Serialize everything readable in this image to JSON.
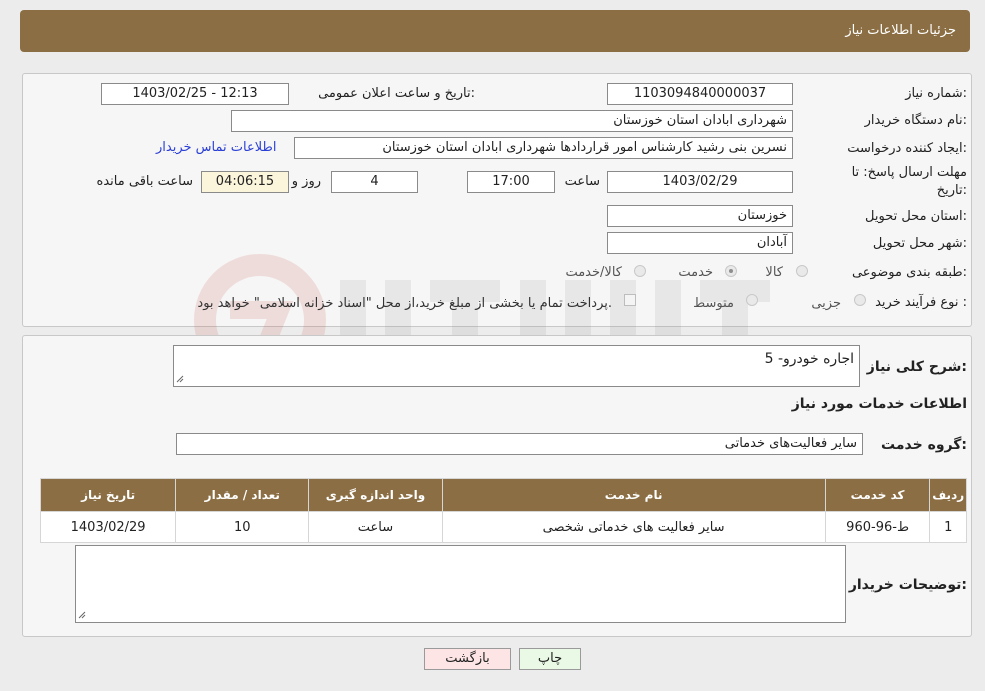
{
  "header": {
    "title": "جزئیات اطلاعات نیاز"
  },
  "form": {
    "need_number_label": "شماره نیاز:",
    "need_number": "1103094840000037",
    "announce_label": "تاریخ و ساعت اعلان عمومی:",
    "announce_value": "1403/02/25 - 12:13",
    "buyer_org_label": "نام دستگاه خریدار:",
    "buyer_org": "شهرداری ابادان استان خوزستان",
    "creator_label": "ایجاد کننده درخواست:",
    "creator": "نسرین بنی رشید کارشناس امور قراردادها شهرداری ابادان استان خوزستان",
    "contact_link": "اطلاعات تماس خریدار",
    "deadline_label_1": "مهلت ارسال پاسخ: تا",
    "deadline_label_2": "تاریخ:",
    "deadline_date": "1403/02/29",
    "time_label": "ساعت",
    "deadline_time": "17:00",
    "days": "4",
    "days_label": "روز و",
    "remaining_time": "04:06:15",
    "remaining_label": "ساعت باقی مانده",
    "province_label": "استان محل تحویل:",
    "province": "خوزستان",
    "city_label": "شهر محل تحویل:",
    "city": "آبادان",
    "category_label": "طبقه بندی موضوعی:",
    "category_options": [
      "کالا",
      "خدمت",
      "کالا/خدمت"
    ],
    "category_selected": "خدمت",
    "process_label": "نوع فرآیند خرید :",
    "process_options": [
      "جزیی",
      "متوسط"
    ],
    "payment_note": "پرداخت تمام یا بخشی از مبلغ خرید،از محل \"اسناد خزانه اسلامی\" خواهد بود."
  },
  "details": {
    "summary_label": "شرح کلی نیاز:",
    "summary": "اجاره خودرو- 5",
    "services_title": "اطلاعات خدمات مورد نیاز",
    "group_label": "گروه خدمت:",
    "group_value": "سایر فعالیت‌های خدماتی",
    "table": {
      "headers": [
        "ردیف",
        "کد خدمت",
        "نام خدمت",
        "واحد اندازه گیری",
        "تعداد / مقدار",
        "تاریخ نیاز"
      ],
      "rows": [
        [
          "1",
          "ط-96-960",
          "سایر فعالیت های خدماتی شخصی",
          "ساعت",
          "10",
          "1403/02/29"
        ]
      ]
    },
    "buyer_notes_label": "توضیحات خریدار:",
    "buyer_notes": ""
  },
  "buttons": {
    "print": "چاپ",
    "back": "بازگشت"
  },
  "colors": {
    "header_brown": "#8b6e43",
    "link_blue": "#2a3fd6",
    "back_button_bg": "#fde5e5",
    "print_button_bg": "#e9f9e6"
  }
}
